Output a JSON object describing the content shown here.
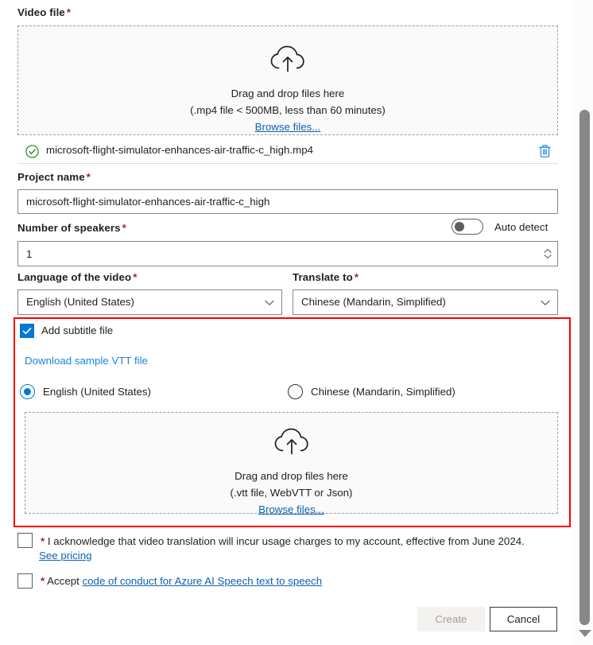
{
  "video_file": {
    "label": "Video file",
    "required_mark": "*",
    "dropzone": {
      "icon": "cloud-upload-icon",
      "line1": "Drag and drop files here",
      "line2": "(.mp4 file < 500MB, less than 60 minutes)",
      "browse_label": "Browse files..."
    },
    "uploaded": {
      "status_icon": "check-circle-icon",
      "name": "microsoft-flight-simulator-enhances-air-traffic-c_high.mp4",
      "delete_icon": "trash-icon"
    }
  },
  "project_name": {
    "label": "Project name",
    "required_mark": "*",
    "value": "microsoft-flight-simulator-enhances-air-traffic-c_high",
    "placeholder": "Project name"
  },
  "speakers": {
    "label": "Number of speakers",
    "required_mark": "*",
    "value": "1",
    "placeholder": "1",
    "auto_detect_label": "Auto detect",
    "auto_detect_on": false
  },
  "video_language": {
    "label": "Language of the video",
    "required_mark": "*",
    "value": "English (United States)"
  },
  "translate_to": {
    "label": "Translate to",
    "required_mark": "*",
    "value": "Chinese (Mandarin, Simplified)"
  },
  "subtitle": {
    "checkbox_label": "Add subtitle file",
    "checked": true,
    "sample_link": "Download sample VTT file",
    "radios": [
      {
        "label": "English (United States)",
        "selected": true
      },
      {
        "label": "Chinese (Mandarin, Simplified)",
        "selected": false
      }
    ],
    "dropzone": {
      "icon": "cloud-upload-icon",
      "line1": "Drag and drop files here",
      "line2": "(.vtt file, WebVTT or Json)",
      "browse_label": "Browse files..."
    }
  },
  "consents": [
    {
      "required_mark": "*",
      "text": "I acknowledge that video translation will incur usage charges to my account, effective from June 2024.",
      "link": "See pricing",
      "checked": false
    },
    {
      "required_mark": "*",
      "text": "Accept",
      "link": "code of conduct for Azure AI Speech text to speech",
      "checked": false
    }
  ],
  "footer": {
    "create_label": "Create",
    "create_disabled": true,
    "cancel_label": "Cancel"
  },
  "colors": {
    "accent": "#0078d4",
    "link": "#0f62b0",
    "required": "#a4262c",
    "highlight": "#ff0000",
    "success": "#107c10",
    "scrollbar": "#878787"
  },
  "scrollbar": {
    "orientation": "vertical",
    "down_arrow_icon": "triangle-down-icon"
  }
}
